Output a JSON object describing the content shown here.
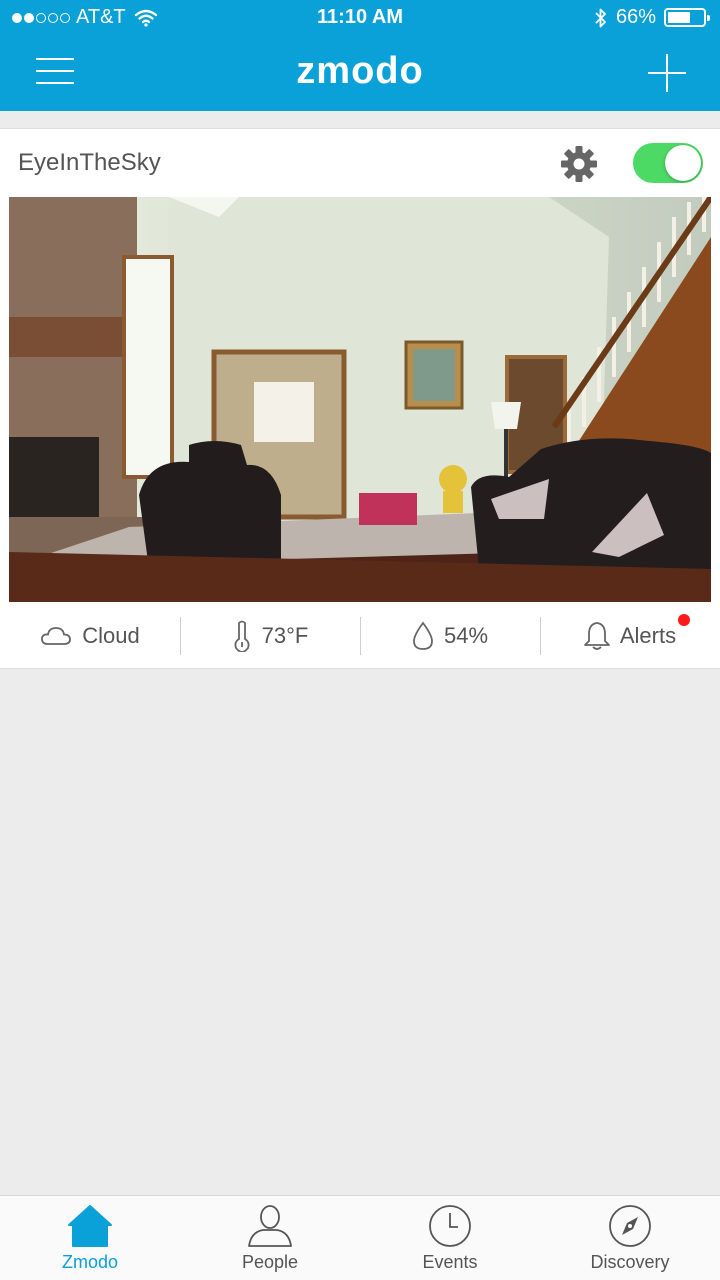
{
  "status_bar": {
    "carrier": "AT&T",
    "signal_bars": 2,
    "time": "11:10 AM",
    "battery_percent": "66%",
    "battery_level": 0.66
  },
  "header": {
    "brand": "zmodo",
    "menu_icon": "hamburger-icon",
    "add_icon": "plus-icon",
    "color": "#0aa0d8"
  },
  "camera": {
    "name": "EyeInTheSky",
    "enabled": true,
    "stats": {
      "cloud": "Cloud",
      "temperature": "73°F",
      "humidity": "54%",
      "alerts": "Alerts"
    }
  },
  "tabs": [
    {
      "label": "Zmodo",
      "icon": "home-icon",
      "active": true
    },
    {
      "label": "People",
      "icon": "person-icon",
      "active": false
    },
    {
      "label": "Events",
      "icon": "clock-icon",
      "active": false
    },
    {
      "label": "Discovery",
      "icon": "compass-icon",
      "active": false
    }
  ]
}
